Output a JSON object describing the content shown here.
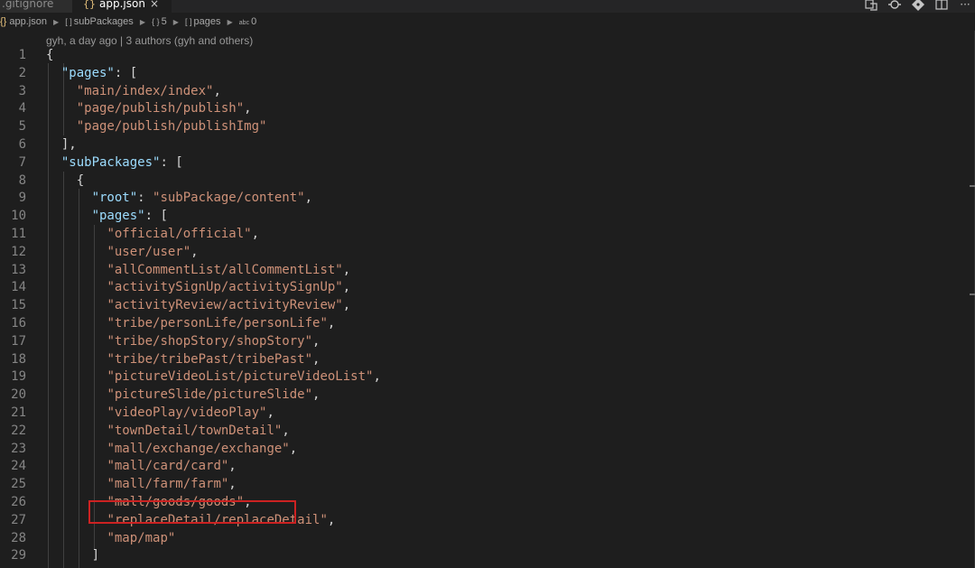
{
  "tabs": [
    {
      "label": ".gitignore",
      "active": false
    },
    {
      "label": "app.json",
      "active": true,
      "icon": "json-braces",
      "close": "×"
    }
  ],
  "toolbar_icons": [
    "compare-changes-icon",
    "open-changes-icon",
    "git-icon",
    "split-editor-icon",
    "more-icon"
  ],
  "breadcrumb": {
    "file": "app.json",
    "items": [
      "subPackages",
      "5",
      "pages",
      "0"
    ]
  },
  "codelens": "gyh, a day ago | 3 authors (gyh and others)",
  "colors": {
    "background": "#1e1e1e",
    "key": "#9cdcfe",
    "string": "#ce9178",
    "punctuation": "#d4d4d4",
    "line_number": "#858585",
    "highlight_box": "#cc2222"
  },
  "highlighted_line": 24,
  "lines": [
    {
      "n": "1",
      "text": "{"
    },
    {
      "n": "2",
      "text": "  \"pages\": ["
    },
    {
      "n": "3",
      "text": "    \"main/index/index\","
    },
    {
      "n": "4",
      "text": "    \"page/publish/publish\","
    },
    {
      "n": "5",
      "text": "    \"page/publish/publishImg\""
    },
    {
      "n": "6",
      "text": "  ],"
    },
    {
      "n": "7",
      "text": "  \"subPackages\": ["
    },
    {
      "n": "8",
      "text": "    {"
    },
    {
      "n": "9",
      "text": "      \"root\": \"subPackage/content\","
    },
    {
      "n": "10",
      "text": "      \"pages\": ["
    },
    {
      "n": "11",
      "text": "        \"official/official\","
    },
    {
      "n": "12",
      "text": "        \"user/user\","
    },
    {
      "n": "13",
      "text": "        \"allCommentList/allCommentList\","
    },
    {
      "n": "14",
      "text": "        \"activitySignUp/activitySignUp\","
    },
    {
      "n": "15",
      "text": "        \"activityReview/activityReview\","
    },
    {
      "n": "16",
      "text": "        \"tribe/personLife/personLife\","
    },
    {
      "n": "17",
      "text": "        \"tribe/shopStory/shopStory\","
    },
    {
      "n": "18",
      "text": "        \"tribe/tribePast/tribePast\","
    },
    {
      "n": "19",
      "text": "        \"pictureVideoList/pictureVideoList\","
    },
    {
      "n": "20",
      "text": "        \"pictureSlide/pictureSlide\","
    },
    {
      "n": "21",
      "text": "        \"videoPlay/videoPlay\","
    },
    {
      "n": "22",
      "text": "        \"townDetail/townDetail\","
    },
    {
      "n": "23",
      "text": "        \"mall/exchange/exchange\","
    },
    {
      "n": "24",
      "text": "        \"mall/card/card\","
    },
    {
      "n": "25",
      "text": "        \"mall/farm/farm\","
    },
    {
      "n": "26",
      "text": "        \"mall/goods/goods\","
    },
    {
      "n": "27",
      "text": "        \"replaceDetail/replaceDetail\","
    },
    {
      "n": "28",
      "text": "        \"map/map\""
    },
    {
      "n": "29",
      "text": "      ]"
    }
  ]
}
